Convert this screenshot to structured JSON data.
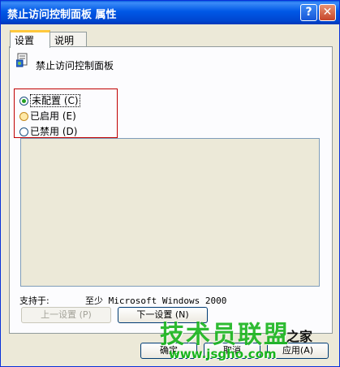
{
  "window": {
    "title": "禁止访问控制面板 属性",
    "help_glyph": "?",
    "close_glyph": "✕"
  },
  "tabs": [
    {
      "label": "设置",
      "active": true
    },
    {
      "label": "说明",
      "active": false
    }
  ],
  "policy": {
    "name": "禁止访问控制面板",
    "icon": "policy-setting-icon"
  },
  "options": [
    {
      "label": "未配置 (C)",
      "checked": true
    },
    {
      "label": "已启用 (E)",
      "checked": false
    },
    {
      "label": "已禁用 (D)",
      "checked": false
    }
  ],
  "supported": {
    "label": "支持于:",
    "value": "至少 Microsoft Windows 2000"
  },
  "nav": {
    "prev_label": "上一设置 (P)",
    "next_label": "下一设置 (N)"
  },
  "footer": {
    "ok_label": "确定",
    "cancel_label": "取消",
    "apply_label": "应用(A)"
  },
  "watermark": {
    "brand": "技术员联盟",
    "suffix": "之家",
    "url": "www.jsgho.com"
  },
  "colors": {
    "title_bar": "#0058e6",
    "highlight_border": "#c00000",
    "watermark": "#18b41c"
  }
}
